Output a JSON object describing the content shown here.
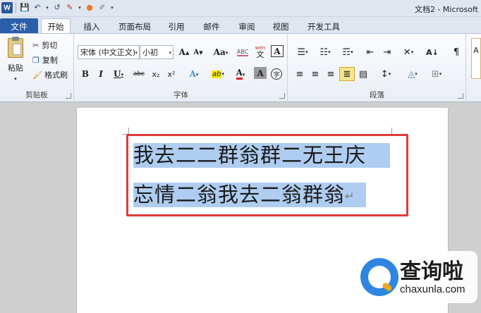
{
  "window": {
    "title": "文档2 - Microsoft",
    "app_icon_letter": "W"
  },
  "qat": {
    "save_icon": "💾",
    "undo_icon": "↶",
    "redo_icon": "↺",
    "format_icon": "✎",
    "theme_icon": "●",
    "draw_icon": "✐",
    "dropdown_icon": "▾"
  },
  "tabs": {
    "file": "文件",
    "items": [
      "开始",
      "插入",
      "页面布局",
      "引用",
      "邮件",
      "审阅",
      "视图",
      "开发工具"
    ]
  },
  "clipboard": {
    "paste": "粘贴",
    "cut": "剪切",
    "copy": "复制",
    "format_painter": "格式刷",
    "label": "剪贴板"
  },
  "font": {
    "name": "宋体 (中文正文)",
    "size": "小初",
    "grow": "A",
    "shrink": "A",
    "case": "Aa",
    "clear": "ABC",
    "phonetic": "wén",
    "border_char": "A",
    "bold": "B",
    "italic": "I",
    "underline": "U",
    "strike": "abc",
    "subscript": "x₂",
    "superscript": "x²",
    "text_effect": "A",
    "highlight": "ab",
    "font_color": "A",
    "shading": "A",
    "enclose": "字",
    "label": "字体"
  },
  "paragraph": {
    "label": "段落"
  },
  "document": {
    "line1": "我去二二群翁群二无王庆",
    "line2": "忘情二翁我去二翁群翁",
    "para_mark": "↵"
  },
  "watermark": {
    "cn": "查询啦",
    "en": "chaxunla.com"
  },
  "colors": {
    "accent": "#2a5ea8",
    "selection": "#aecdf0",
    "highlight_box": "#e03a3a",
    "highlight_yellow": "#f6e58d"
  }
}
